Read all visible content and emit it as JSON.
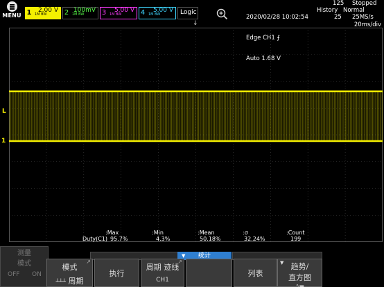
{
  "topbar": {
    "menu_label": "MENU",
    "channels": [
      {
        "num": "1",
        "value": "2.00 V",
        "sub": "1M\nBW",
        "color": "#f5f000"
      },
      {
        "num": "2",
        "value": "100mV",
        "sub": "1M\nBW",
        "color": "#59ff4a"
      },
      {
        "num": "3",
        "value": "5.00 V",
        "sub": "1M\nBW",
        "color": "#ff3cff"
      },
      {
        "num": "4",
        "value": "5.00 V",
        "sub": "1M\nBW",
        "color": "#3fd6ff"
      }
    ],
    "logic_label": "Logic",
    "datetime": "2020/02/28 10:02:54",
    "trigger_line": "Edge CH1",
    "trigger_level": "Auto 1.68 V",
    "history_label": "History",
    "history_count": "125",
    "history_index": "25",
    "run_state": "Stopped",
    "acq_mode": "Normal",
    "sample_rate": "25MS/s"
  },
  "screen": {
    "timebase": "20ms/div",
    "trigger_position_mark": "↓",
    "level_marker": "L",
    "ground_marker": "1",
    "trace_color": "#f5f000"
  },
  "stats": {
    "row_label": "Duty(C1)",
    "headers": [
      ":Max",
      ":Min",
      ":Mean",
      ":σ",
      ":Count"
    ],
    "values": [
      "95.7%",
      "4.3%",
      "50.18%",
      "32.24%",
      "199"
    ]
  },
  "softkeys": {
    "measure_label": "测量",
    "mode_label": "模式",
    "off_label": "OFF",
    "on_label": "ON",
    "mode2_label": "模式",
    "period_label": "周期",
    "execute_label": "执行",
    "period_trace_label": "周期 迹线",
    "channel_label": "CH1",
    "stats_tab_label": "统计",
    "list_label": "列表",
    "trend_label_1": "趋势/",
    "trend_label_2": "直方图"
  }
}
